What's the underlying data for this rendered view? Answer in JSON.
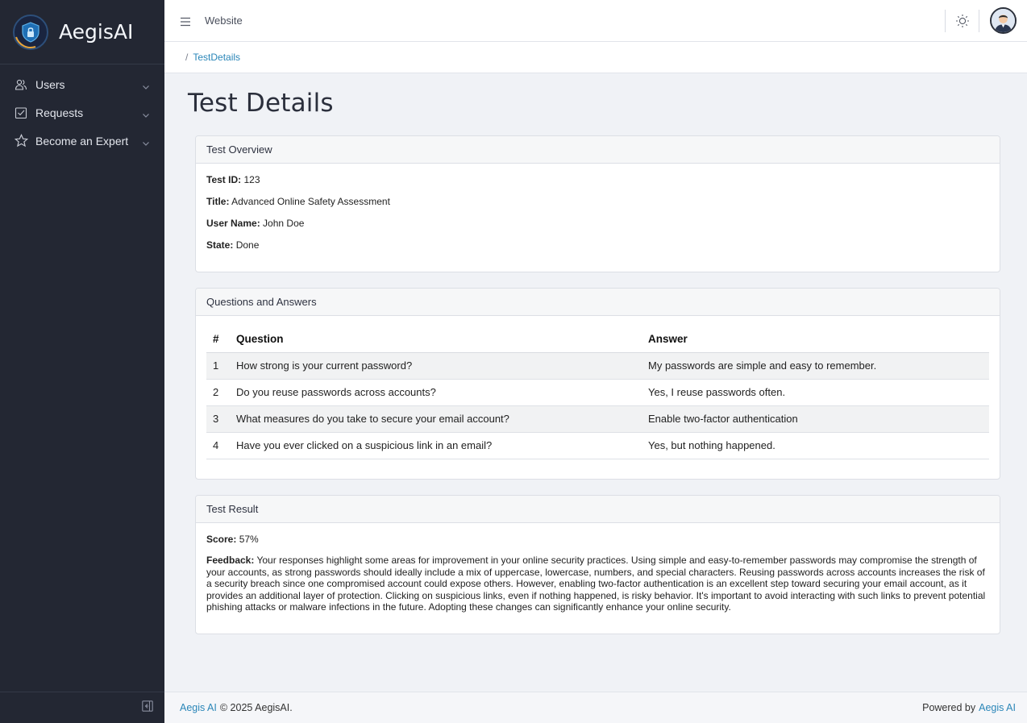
{
  "brand": {
    "name": "AegisAI"
  },
  "sidebar": {
    "items": [
      {
        "label": "Users",
        "icon": "users-icon"
      },
      {
        "label": "Requests",
        "icon": "checklist-icon"
      },
      {
        "label": "Become an Expert",
        "icon": "star-icon"
      }
    ]
  },
  "header": {
    "site_label": "Website"
  },
  "breadcrumb": {
    "separator": "/",
    "current": "TestDetails"
  },
  "page": {
    "title": "Test Details"
  },
  "overview": {
    "header": "Test Overview",
    "fields": [
      {
        "label": "Test ID:",
        "value": "123"
      },
      {
        "label": "Title:",
        "value": "Advanced Online Safety Assessment"
      },
      {
        "label": "User Name:",
        "value": "John Doe"
      },
      {
        "label": "State:",
        "value": "Done"
      }
    ]
  },
  "qa": {
    "header": "Questions and Answers",
    "columns": [
      "#",
      "Question",
      "Answer"
    ],
    "rows": [
      {
        "num": "1",
        "question": "How strong is your current password?",
        "answer": "My passwords are simple and easy to remember."
      },
      {
        "num": "2",
        "question": "Do you reuse passwords across accounts?",
        "answer": "Yes, I reuse passwords often."
      },
      {
        "num": "3",
        "question": "What measures do you take to secure your email account?",
        "answer": "Enable two-factor authentication"
      },
      {
        "num": "4",
        "question": "Have you ever clicked on a suspicious link in an email?",
        "answer": "Yes, but nothing happened."
      }
    ]
  },
  "result": {
    "header": "Test Result",
    "score_label": "Score:",
    "score": "57%",
    "feedback_label": "Feedback:",
    "feedback": "Your responses highlight some areas for improvement in your online security practices. Using simple and easy-to-remember passwords may compromise the strength of your accounts, as strong passwords should ideally include a mix of uppercase, lowercase, numbers, and special characters. Reusing passwords across accounts increases the risk of a security breach since one compromised account could expose others. However, enabling two-factor authentication is an excellent step toward securing your email account, as it provides an additional layer of protection. Clicking on suspicious links, even if nothing happened, is risky behavior. It's important to avoid interacting with such links to prevent potential phishing attacks or malware infections in the future. Adopting these changes can significantly enhance your online security."
  },
  "footer": {
    "left_link": "Aegis AI",
    "left_text": "© 2025 AegisAI.",
    "right_text": "Powered by",
    "right_link": "Aegis AI"
  },
  "colors": {
    "sidebar_bg": "#232733",
    "accent": "#2a86b8",
    "page_bg": "#f0f2f6"
  }
}
